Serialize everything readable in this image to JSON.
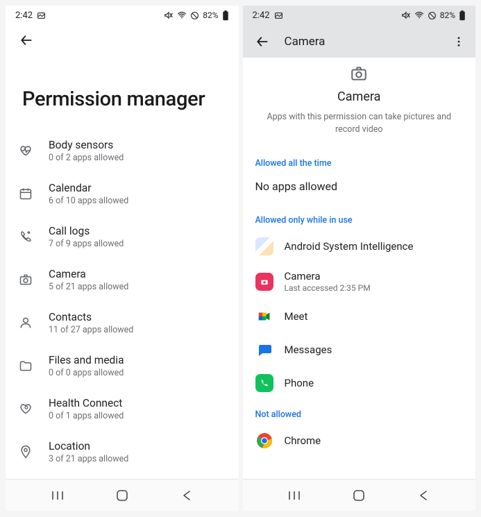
{
  "statusbar": {
    "time": "2:42",
    "battery": "82%"
  },
  "left": {
    "title": "Permission manager",
    "items": [
      {
        "icon": "heart-pulse",
        "label": "Body sensors",
        "sub": "0 of 2 apps allowed"
      },
      {
        "icon": "calendar",
        "label": "Calendar",
        "sub": "6 of 10 apps allowed"
      },
      {
        "icon": "phone-log",
        "label": "Call logs",
        "sub": "7 of 9 apps allowed"
      },
      {
        "icon": "camera",
        "label": "Camera",
        "sub": "5 of 21 apps allowed"
      },
      {
        "icon": "contact",
        "label": "Contacts",
        "sub": "11 of 27 apps allowed"
      },
      {
        "icon": "folder",
        "label": "Files and media",
        "sub": "0 of 0 apps allowed"
      },
      {
        "icon": "health",
        "label": "Health Connect",
        "sub": "0 of 1 apps allowed"
      },
      {
        "icon": "location",
        "label": "Location",
        "sub": "3 of 21 apps allowed"
      }
    ]
  },
  "right": {
    "header_title": "Camera",
    "page_title": "Camera",
    "page_desc": "Apps with this permission can take pictures and record video",
    "sections": {
      "allowed_all": {
        "label": "Allowed all the time",
        "empty": "No apps allowed"
      },
      "allowed_while": {
        "label": "Allowed only while in use",
        "apps": [
          {
            "name": "Android System Intelligence",
            "icon": "asi",
            "sub": ""
          },
          {
            "name": "Camera",
            "icon": "cam-app",
            "sub": "Last accessed 2:35 PM"
          },
          {
            "name": "Meet",
            "icon": "meet",
            "sub": ""
          },
          {
            "name": "Messages",
            "icon": "messages",
            "sub": ""
          },
          {
            "name": "Phone",
            "icon": "phone-app",
            "sub": ""
          }
        ]
      },
      "not_allowed": {
        "label": "Not allowed",
        "apps": [
          {
            "name": "Chrome",
            "icon": "chrome",
            "sub": ""
          }
        ]
      }
    }
  }
}
